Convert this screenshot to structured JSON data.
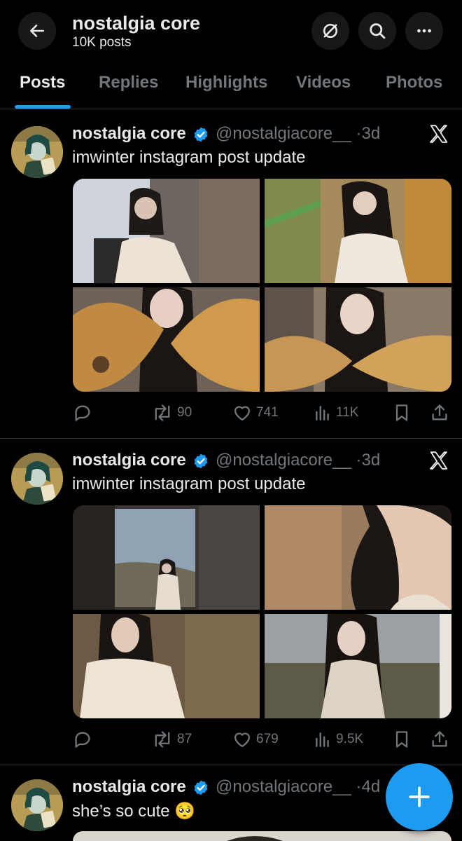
{
  "header": {
    "name": "nostalgia core",
    "post_count": "10K posts",
    "icons": [
      "back-arrow-icon",
      "grok-icon",
      "search-icon",
      "more-icon"
    ]
  },
  "tabs": [
    {
      "label": "Posts",
      "active": true
    },
    {
      "label": "Replies",
      "active": false
    },
    {
      "label": "Highlights",
      "active": false
    },
    {
      "label": "Videos",
      "active": false
    },
    {
      "label": "Photos",
      "active": false
    }
  ],
  "posts": [
    {
      "author": "nostalgia core",
      "handle": "@nostalgiacore__",
      "time": "3d",
      "text": "imwinter instagram post update",
      "replies": "",
      "reposts": "90",
      "likes": "741",
      "views": "11K"
    },
    {
      "author": "nostalgia core",
      "handle": "@nostalgiacore__",
      "time": "3d",
      "text": "imwinter instagram post update",
      "replies": "",
      "reposts": "87",
      "likes": "679",
      "views": "9.5K"
    },
    {
      "author": "nostalgia core",
      "handle": "@nostalgiacore__",
      "time": "4d",
      "text": "she’s so cute 🥺"
    }
  ],
  "colors": {
    "accent": "#1d9bf0",
    "muted": "#71767b",
    "text": "#e7e9ea",
    "background": "#000000",
    "divider": "#2f3336"
  },
  "fab_icon": "plus-icon"
}
